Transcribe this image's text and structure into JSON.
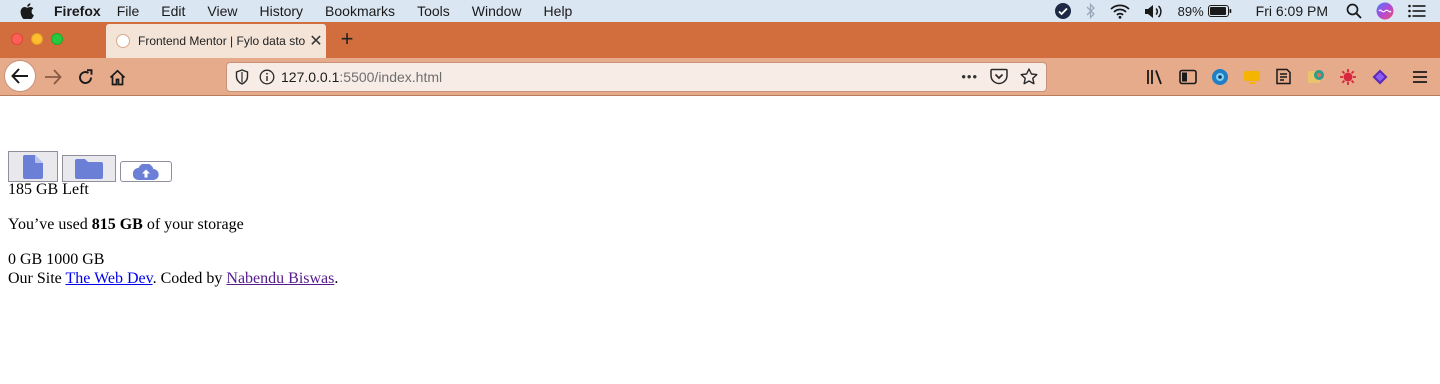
{
  "menubar": {
    "app_name": "Firefox",
    "items": [
      "File",
      "Edit",
      "View",
      "History",
      "Bookmarks",
      "Tools",
      "Window",
      "Help"
    ],
    "battery": "89%",
    "clock": "Fri 6:09 PM"
  },
  "tab": {
    "title": "Frontend Mentor | Fylo data sto",
    "close_label": "✕"
  },
  "newtab_label": "+",
  "urlbar": {
    "host": "127.0.0.1",
    "path": ":5500/index.html",
    "more_label": "•••"
  },
  "page": {
    "gb_left": "185 GB Left",
    "used_prefix": "You’ve used ",
    "used_amount": "815 GB",
    "used_suffix": " of your storage",
    "scale_min": "0 GB",
    "scale_max": "1000 GB",
    "footer_prefix": "Our Site ",
    "footer_link1": "The Web Dev",
    "footer_middle": ". Coded by ",
    "footer_link2": "Nabendu Biswas",
    "footer_suffix": "."
  },
  "colors": {
    "tabstrip": "#d26e3e",
    "navbar": "#e5ab8a",
    "icon_accent": "#6b7fd7"
  },
  "icons": {
    "file_button": "document-icon",
    "folder_button": "folder-icon",
    "upload_button": "cloud-upload-icon"
  }
}
